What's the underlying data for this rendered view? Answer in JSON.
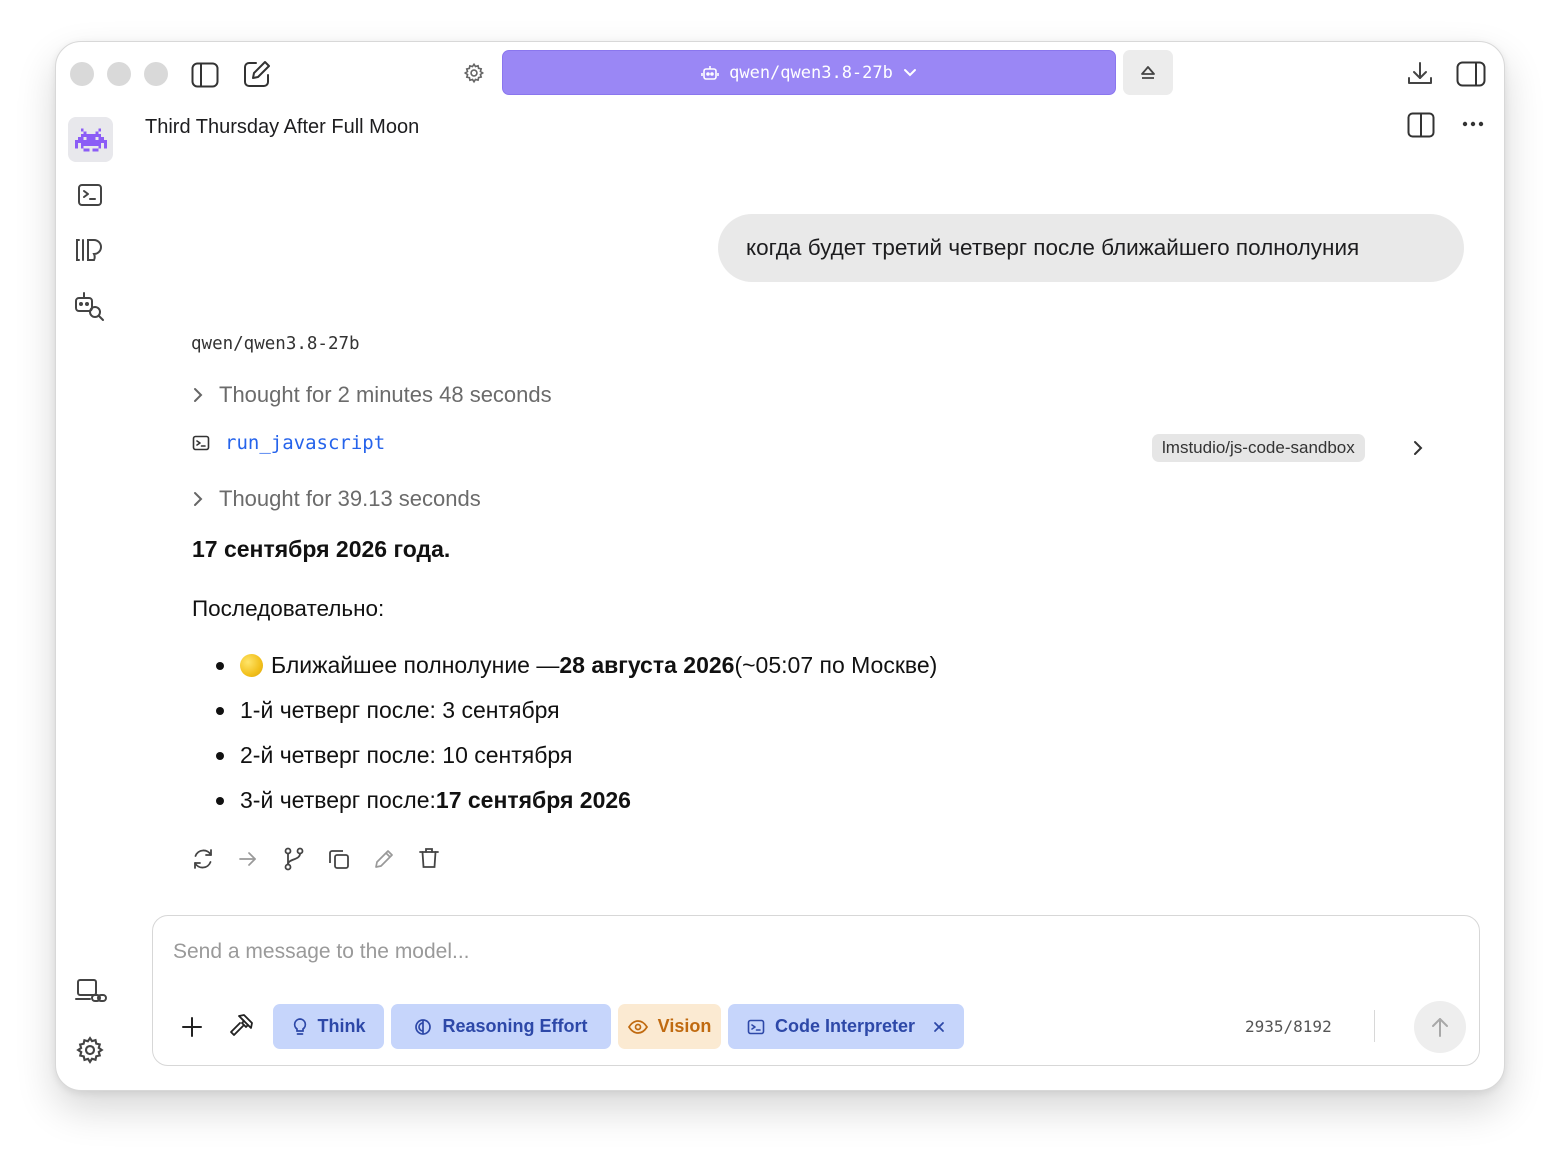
{
  "header": {
    "model_selector": "qwen/qwen3.8-27b"
  },
  "chat": {
    "title": "Third Thursday After Full Moon",
    "user_message": "когда будет третий четверг после ближайшего полнолуния",
    "model_name": "qwen/qwen3.8-27b",
    "thought_1": "Thought for 2 minutes 48 seconds",
    "tool_call": {
      "name": "run_javascript",
      "plugin": "lmstudio/js-code-sandbox"
    },
    "thought_2": "Thought for 39.13 seconds",
    "answer_title": "17 сентября 2026 года.",
    "sequence_label": "Последовательно:",
    "items": [
      {
        "pre": "Ближайшее полнолуние — ",
        "bold": "28 августа 2026",
        "post": " (~05:07 по Москве)"
      },
      {
        "pre": "1-й четверг после: 3 сентября",
        "bold": "",
        "post": ""
      },
      {
        "pre": "2-й четверг после: 10 сентября",
        "bold": "",
        "post": ""
      },
      {
        "pre": "3-й четверг после: ",
        "bold": "17 сентября 2026",
        "post": ""
      }
    ]
  },
  "composer": {
    "placeholder": "Send a message to the model...",
    "chips": {
      "think": "Think",
      "reasoning": "Reasoning Effort",
      "vision": "Vision",
      "code": "Code Interpreter"
    },
    "token_count": "2935/8192"
  },
  "colors": {
    "accent": "#9a87f5",
    "link": "#2563eb",
    "chip_blue_bg": "#c6d5fb",
    "chip_orange_bg": "#fbead2"
  }
}
